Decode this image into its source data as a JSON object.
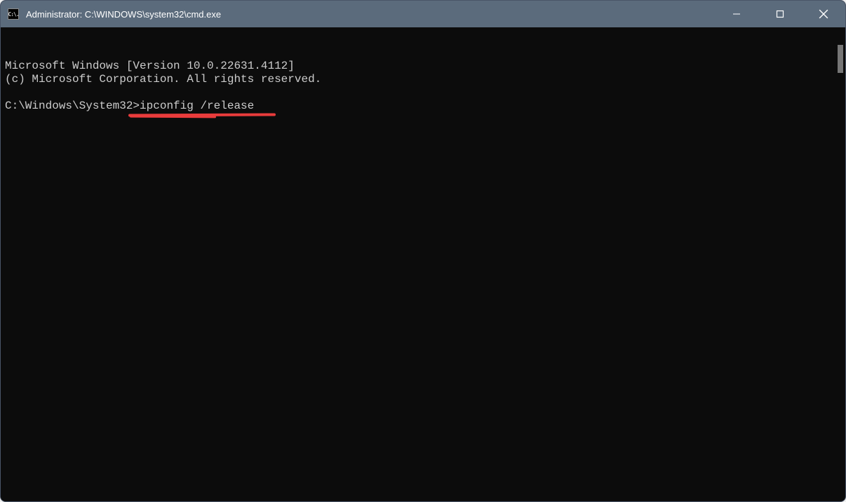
{
  "window": {
    "title": "Administrator: C:\\WINDOWS\\system32\\cmd.exe",
    "icon_label": "C:\\."
  },
  "terminal": {
    "line1": "Microsoft Windows [Version 10.0.22631.4112]",
    "line2": "(c) Microsoft Corporation. All rights reserved.",
    "blank": "",
    "prompt": "C:\\Windows\\System32>",
    "command": "ipconfig /release"
  },
  "annotation": {
    "color": "#e93c3c"
  }
}
